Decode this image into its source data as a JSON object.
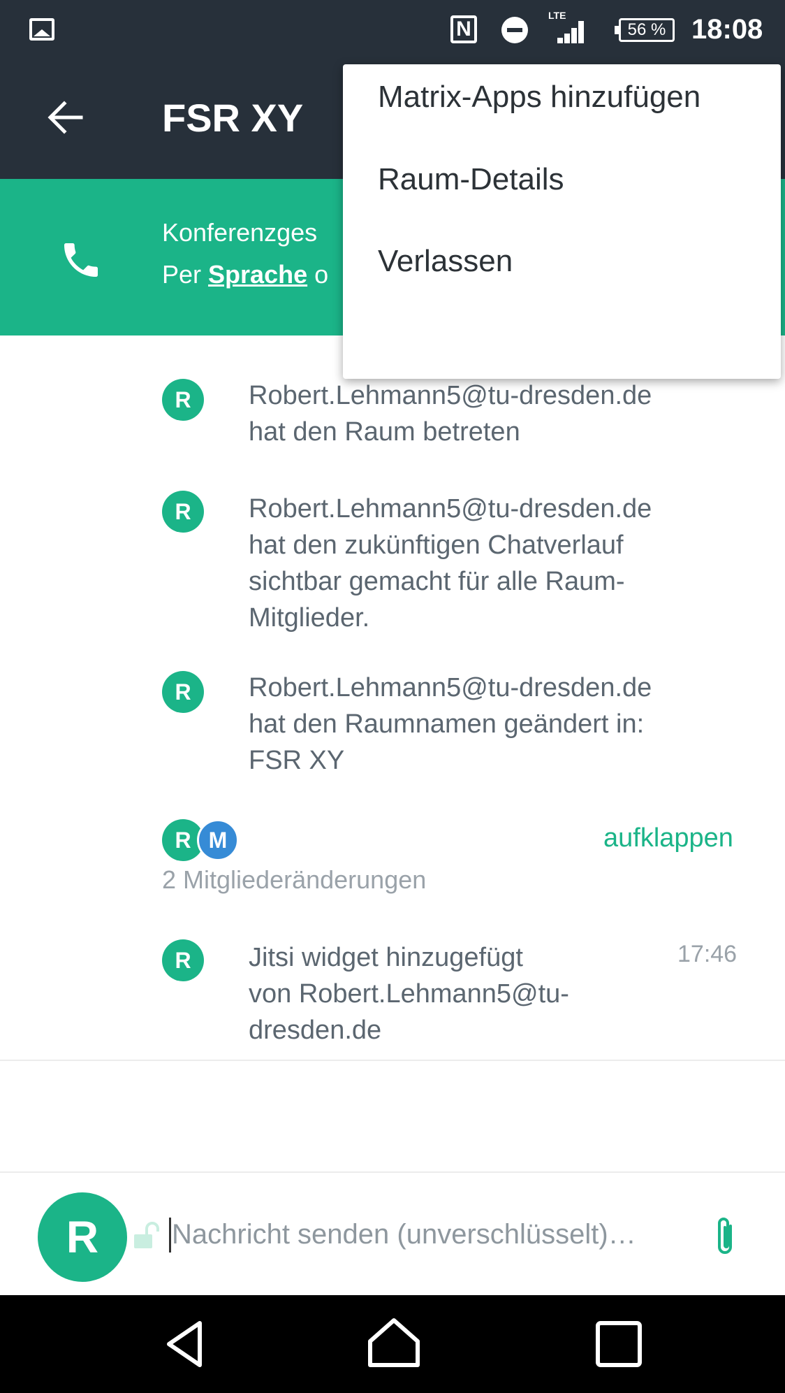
{
  "status_bar": {
    "nfc": "N",
    "network": "LTE",
    "battery": "56 %",
    "time": "18:08"
  },
  "app_bar": {
    "title": "FSR XY"
  },
  "call_banner": {
    "line1": "Konferenzges",
    "line2_prefix": "Per ",
    "line2_link": "Sprache",
    "line2_suffix": " o"
  },
  "menu": {
    "items": [
      "Matrix-Apps hinzufügen",
      "Raum-Details",
      "Verlassen"
    ]
  },
  "timeline": {
    "events": [
      {
        "avatar": "R",
        "lines": [
          "Robert.Lehmann5@tu-dresden.de",
          "hat den Raum betreten"
        ]
      },
      {
        "avatar": "R",
        "lines": [
          "Robert.Lehmann5@tu-dresden.de",
          "hat den zukünftigen Chatverlauf",
          "sichtbar gemacht für alle Raum-",
          "Mitglieder."
        ]
      },
      {
        "avatar": "R",
        "lines": [
          "Robert.Lehmann5@tu-dresden.de",
          "hat den Raumnamen geändert in:",
          "FSR XY"
        ]
      }
    ],
    "member_group": {
      "avatars": [
        "R",
        "M"
      ],
      "expand_label": "aufklappen",
      "summary": "2 Mitgliederänderungen"
    },
    "widget_event": {
      "avatar": "R",
      "lines": [
        "Jitsi widget hinzugefügt",
        "von Robert.Lehmann5@tu-",
        "dresden.de"
      ],
      "time": "17:46"
    }
  },
  "composer": {
    "avatar": "R",
    "placeholder": "Nachricht senden (unverschlüsselt)…"
  },
  "colors": {
    "bar": "#27303a",
    "accent": "#1bb488",
    "avatar_m": "#368bd6"
  }
}
